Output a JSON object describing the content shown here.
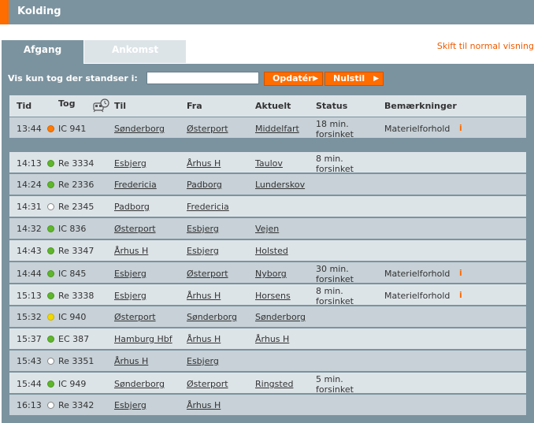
{
  "header": {
    "title": "Kolding"
  },
  "tabs": {
    "departure": "Afgang",
    "arrival": "Ankomst"
  },
  "switch_view": "Skift til normal visning",
  "filter": {
    "label": "Vis kun tog der standser i:",
    "value": "",
    "update_label": "Opdatér",
    "reset_label": "Nulstil"
  },
  "columns": {
    "time": "Tid",
    "train": "Tog",
    "to": "Til",
    "from": "Fra",
    "current": "Aktuelt",
    "status": "Status",
    "remarks": "Bemærkninger"
  },
  "colors": {
    "accent": "#ff6c00",
    "panel": "#7b939f"
  },
  "featured": [
    {
      "time": "13:44",
      "dot": "orange",
      "train": "IC 941",
      "to": "Sønderborg",
      "from": "Østerport",
      "current": "Middelfart",
      "status1": "18 min.",
      "status2": "forsinket",
      "remark": "Materielforhold",
      "info": "i"
    }
  ],
  "rows": [
    {
      "time": "14:13",
      "dot": "green",
      "train": "Re 3334",
      "to": "Esbjerg",
      "from": "Århus H",
      "current": "Taulov",
      "status1": "8 min.",
      "status2": "forsinket",
      "remark": "",
      "info": ""
    },
    {
      "time": "14:24",
      "dot": "green",
      "train": "Re 2336",
      "to": "Fredericia",
      "from": "Padborg",
      "current": "Lunderskov",
      "status1": "",
      "status2": "",
      "remark": "",
      "info": ""
    },
    {
      "time": "14:31",
      "dot": "white",
      "train": "Re 2345",
      "to": "Padborg",
      "from": "Fredericia",
      "current": "",
      "status1": "",
      "status2": "",
      "remark": "",
      "info": ""
    },
    {
      "time": "14:32",
      "dot": "green",
      "train": "IC 836",
      "to": "Østerport",
      "from": "Esbjerg",
      "current": "Vejen",
      "status1": "",
      "status2": "",
      "remark": "",
      "info": ""
    },
    {
      "time": "14:43",
      "dot": "green",
      "train": "Re 3347",
      "to": "Århus H",
      "from": "Esbjerg",
      "current": "Holsted",
      "status1": "",
      "status2": "",
      "remark": "",
      "info": ""
    },
    {
      "time": "14:44",
      "dot": "green",
      "train": "IC 845",
      "to": "Esbjerg",
      "from": "Østerport",
      "current": "Nyborg",
      "status1": "30 min.",
      "status2": "forsinket",
      "remark": "Materielforhold",
      "info": "i"
    },
    {
      "time": "15:13",
      "dot": "green",
      "train": "Re 3338",
      "to": "Esbjerg",
      "from": "Århus H",
      "current": "Horsens",
      "status1": "8 min.",
      "status2": "forsinket",
      "remark": "Materielforhold",
      "info": "i"
    },
    {
      "time": "15:32",
      "dot": "yellow",
      "train": "IC 940",
      "to": "Østerport",
      "from": "Sønderborg",
      "current": "Sønderborg",
      "status1": "",
      "status2": "",
      "remark": "",
      "info": ""
    },
    {
      "time": "15:37",
      "dot": "green",
      "train": "EC 387",
      "to": "Hamburg Hbf",
      "from": "Århus H",
      "current": "Århus H",
      "status1": "",
      "status2": "",
      "remark": "",
      "info": ""
    },
    {
      "time": "15:43",
      "dot": "white",
      "train": "Re 3351",
      "to": "Århus H",
      "from": "Esbjerg",
      "current": "",
      "status1": "",
      "status2": "",
      "remark": "",
      "info": ""
    },
    {
      "time": "15:44",
      "dot": "green",
      "train": "IC 949",
      "to": "Sønderborg",
      "from": "Østerport",
      "current": "Ringsted",
      "status1": "5 min.",
      "status2": "forsinket",
      "remark": "",
      "info": ""
    },
    {
      "time": "16:13",
      "dot": "white",
      "train": "Re 3342",
      "to": "Esbjerg",
      "from": "Århus H",
      "current": "",
      "status1": "",
      "status2": "",
      "remark": "",
      "info": ""
    }
  ]
}
